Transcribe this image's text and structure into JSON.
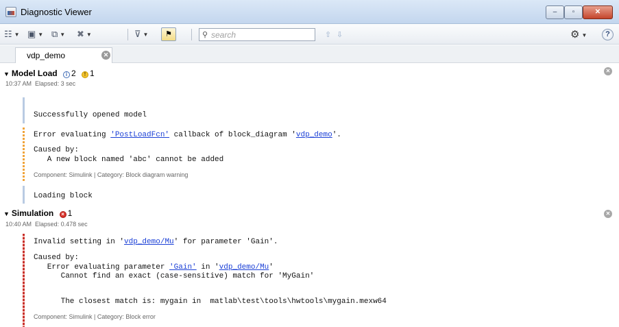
{
  "window": {
    "title": "Diagnostic Viewer",
    "min_glyph": "‒",
    "max_glyph": "▫",
    "close_glyph": "✕"
  },
  "toolbar": {
    "search_placeholder": "search",
    "icons": [
      "expand-collapse-icon",
      "save-icon",
      "copy-icon",
      "clear-icon",
      "filter-icon",
      "highlight-warnings-icon",
      "search-icon",
      "up-arrow-icon",
      "down-arrow-icon",
      "settings-gear-icon",
      "help-icon"
    ]
  },
  "tabs": [
    {
      "label": "vdp_demo"
    }
  ],
  "groups": [
    {
      "name": "Model Load",
      "info_count": "2",
      "warn_count": "1",
      "time": "10:37 AM",
      "elapsed": "Elapsed: 3 sec",
      "messages": [
        {
          "severity": "info",
          "text": "Successfully opened model"
        },
        {
          "severity": "warning",
          "line1_pre": "Error evaluating ",
          "line1_link1": "'PostLoadFcn'",
          "line1_mid": " callback of block_diagram '",
          "line1_link2": "vdp_demo",
          "line1_post": "'.",
          "caused_by": "Caused by:",
          "cause_text": "   A new block named 'abc' cannot be added",
          "component": "Component: Simulink | Category: Block diagram warning"
        },
        {
          "severity": "info",
          "text": "Loading block"
        }
      ]
    },
    {
      "name": "Simulation",
      "err_count": "1",
      "time": "10:40 AM",
      "elapsed": "Elapsed: 0.478 sec",
      "messages": [
        {
          "severity": "error",
          "line1_pre": "Invalid setting in '",
          "line1_link": "vdp_demo/Mu",
          "line1_post": "' for parameter 'Gain'.",
          "caused_by": "Caused by:",
          "cause_pre": "   Error evaluating parameter ",
          "cause_link1": "'Gain'",
          "cause_mid": " in '",
          "cause_link2": "vdp_demo/Mu",
          "cause_post": "'",
          "detail1": "      Cannot find an exact (case-sensitive) match for 'MyGain'",
          "detail2": "      The closest match is: mygain in  matlab\\test\\tools\\hwtools\\mygain.mexw64",
          "component": "Component: Simulink | Category: Block error"
        }
      ]
    }
  ]
}
